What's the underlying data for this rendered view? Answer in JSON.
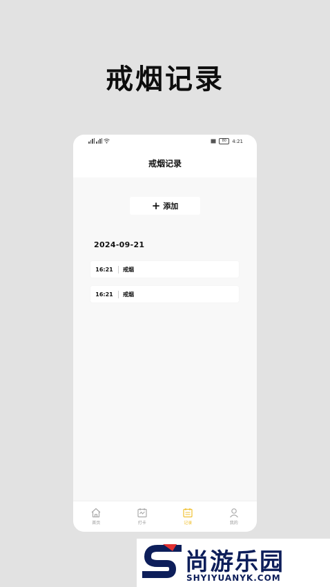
{
  "hero": {
    "title": "戒烟记录"
  },
  "status_bar": {
    "time": "4:21",
    "battery": "80"
  },
  "header": {
    "title": "戒烟记录"
  },
  "add_button": {
    "label": "添加"
  },
  "records": {
    "date": "2024-09-21",
    "items": [
      {
        "time": "16:21",
        "event": "戒烟"
      },
      {
        "time": "16:21",
        "event": "戒烟"
      }
    ]
  },
  "tabs": [
    {
      "label": "首页",
      "icon": "home-icon"
    },
    {
      "label": "打卡",
      "icon": "calendar-check-icon"
    },
    {
      "label": "记录",
      "icon": "record-icon",
      "active": true
    },
    {
      "label": "我的",
      "icon": "user-icon"
    }
  ],
  "colors": {
    "accent": "#f0c030",
    "background": "#e2e2e2",
    "page": "#f8f8f8"
  },
  "watermark": {
    "cn": "尚游乐园",
    "en": "SHYIYUANYK.COM"
  }
}
